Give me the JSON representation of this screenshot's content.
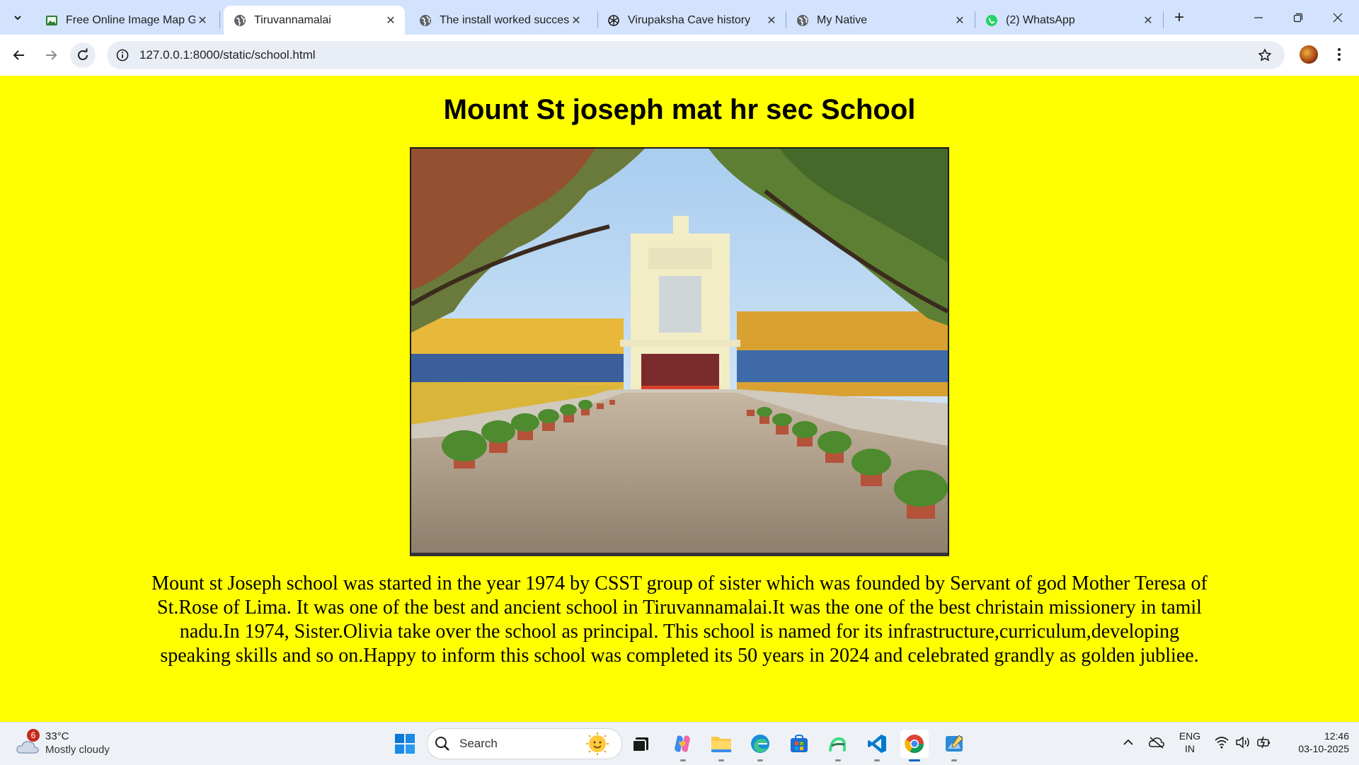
{
  "browser": {
    "tabs": [
      {
        "title": "Free Online Image Map Ge",
        "favicon": "image-icon",
        "active": false
      },
      {
        "title": "Tiruvannamalai",
        "favicon": "globe-icon",
        "active": true
      },
      {
        "title": "The install worked successf",
        "favicon": "globe-icon",
        "active": false
      },
      {
        "title": "Virupaksha Cave history",
        "favicon": "openai-icon",
        "active": false
      },
      {
        "title": "My Native",
        "favicon": "globe-icon",
        "active": false
      },
      {
        "title": "(2) WhatsApp",
        "favicon": "whatsapp-icon",
        "active": false
      }
    ],
    "url": "127.0.0.1:8000/static/school.html",
    "colors": {
      "tabstrip": "#d3e3fd",
      "omnibox": "#e9eef6"
    }
  },
  "page": {
    "heading": "Mount St joseph mat hr sec School",
    "paragraph": "Mount st Joseph school was started in the year 1974 by CSST group of sister which was founded by Servant of god Mother Teresa of St.Rose of Lima. It was one of the best and ancient school in Tiruvannamalai.It was the one of the best christain missionery in tamil nadu.In 1974, Sister.Olivia take over the school as principal. This school is named for its infrastructure,curriculum,developing speaking skills and so on.Happy to inform this school was completed its 50 years in 2024 and celebrated grandly as golden jubliee.",
    "background": "#ffff00"
  },
  "taskbar": {
    "weather": {
      "badge": "6",
      "temp": "33°C",
      "condition": "Mostly cloudy"
    },
    "search_placeholder": "Search",
    "apps": [
      "task-view-icon",
      "copilot-icon",
      "file-explorer-icon",
      "edge-icon",
      "microsoft-store-icon",
      "android-studio-icon",
      "vscode-icon",
      "chrome-icon",
      "paint-icon"
    ],
    "language": {
      "line1": "ENG",
      "line2": "IN"
    },
    "clock": {
      "time": "12:46",
      "date": "03-10-2025"
    }
  }
}
